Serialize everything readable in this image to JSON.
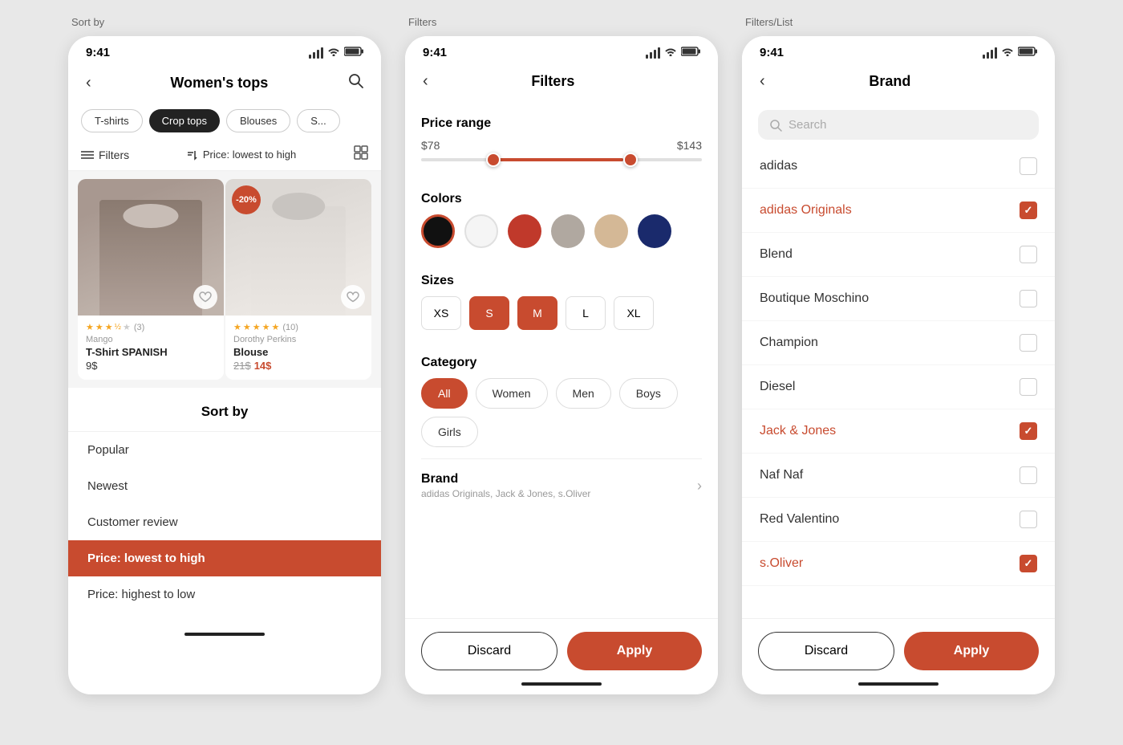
{
  "screens": [
    {
      "label": "Sort by",
      "type": "sort",
      "status": {
        "time": "9:41"
      },
      "nav": {
        "title": "Women's tops",
        "back": "‹",
        "search": "🔍"
      },
      "categories": [
        {
          "label": "T-shirts",
          "active": false
        },
        {
          "label": "Crop tops",
          "active": true
        },
        {
          "label": "Blouses",
          "active": false
        },
        {
          "label": "S...",
          "active": false
        }
      ],
      "toolbar": {
        "filter_label": "Filters",
        "sort_label": "Price: lowest to high"
      },
      "products": [
        {
          "brand": "Mango",
          "name": "T-Shirt SPANISH",
          "price": "9$",
          "price_sale": null,
          "price_original": null,
          "discount": null,
          "stars": 3.5,
          "reviews": 3,
          "image_type": "left"
        },
        {
          "brand": "Dorothy Perkins",
          "name": "Blouse",
          "price": null,
          "price_sale": "14$",
          "price_original": "21$",
          "discount": "-20%",
          "stars": 5,
          "reviews": 10,
          "image_type": "right"
        }
      ],
      "sort_options": [
        {
          "label": "Popular",
          "active": false
        },
        {
          "label": "Newest",
          "active": false
        },
        {
          "label": "Customer review",
          "active": false
        },
        {
          "label": "Price: lowest to high",
          "active": true
        },
        {
          "label": "Price: highest to low",
          "active": false
        }
      ]
    },
    {
      "label": "Filters",
      "type": "filters",
      "status": {
        "time": "9:41"
      },
      "nav": {
        "title": "Filters",
        "back": "‹"
      },
      "price_range": {
        "section_label": "Price range",
        "min": "$78",
        "max": "$143",
        "fill_left_pct": 23,
        "fill_right_pct": 72
      },
      "colors": {
        "section_label": "Colors",
        "items": [
          {
            "name": "black",
            "selected": true
          },
          {
            "name": "white",
            "selected": false
          },
          {
            "name": "red",
            "selected": false
          },
          {
            "name": "gray",
            "selected": false
          },
          {
            "name": "beige",
            "selected": false
          },
          {
            "name": "navy",
            "selected": false
          }
        ]
      },
      "sizes": {
        "section_label": "Sizes",
        "items": [
          {
            "label": "XS",
            "active": false
          },
          {
            "label": "S",
            "active": true
          },
          {
            "label": "M",
            "active": true
          },
          {
            "label": "L",
            "active": false
          },
          {
            "label": "XL",
            "active": false
          }
        ]
      },
      "category": {
        "section_label": "Category",
        "items": [
          {
            "label": "All",
            "active": true
          },
          {
            "label": "Women",
            "active": false
          },
          {
            "label": "Men",
            "active": false
          },
          {
            "label": "Boys",
            "active": false
          },
          {
            "label": "Girls",
            "active": false
          }
        ]
      },
      "brand": {
        "section_label": "Brand",
        "subtitle": "adidas Originals, Jack & Jones, s.Oliver",
        "arrow": "›"
      },
      "actions": {
        "discard": "Discard",
        "apply": "Apply"
      }
    },
    {
      "label": "Filters/List",
      "type": "brand_list",
      "status": {
        "time": "9:41"
      },
      "nav": {
        "title": "Brand",
        "back": "‹"
      },
      "search": {
        "placeholder": "Search"
      },
      "brands": [
        {
          "name": "adidas",
          "selected": false
        },
        {
          "name": "adidas Originals",
          "selected": true
        },
        {
          "name": "Blend",
          "selected": false
        },
        {
          "name": "Boutique Moschino",
          "selected": false
        },
        {
          "name": "Champion",
          "selected": false
        },
        {
          "name": "Diesel",
          "selected": false
        },
        {
          "name": "Jack & Jones",
          "selected": true
        },
        {
          "name": "Naf Naf",
          "selected": false
        },
        {
          "name": "Red Valentino",
          "selected": false
        },
        {
          "name": "s.Oliver",
          "selected": true
        }
      ],
      "actions": {
        "discard": "Discard",
        "apply": "Apply"
      }
    }
  ]
}
